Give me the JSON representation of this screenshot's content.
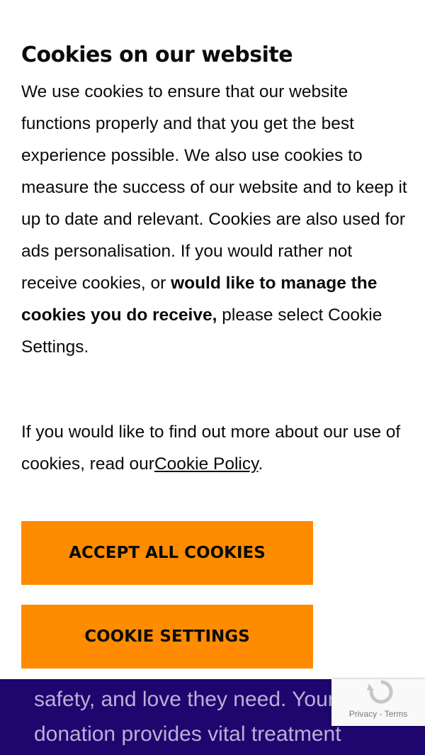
{
  "cookie_banner": {
    "title": "Cookies on our website",
    "body_intro": "We use cookies to ensure that our website functions properly and that you get the best experience possible. We also use cookies to measure the success of our website and to keep it up to date and relevant. Cookies are also used for ads personalisation. If you would rather not receive cookies, or ",
    "body_emphasis": "would like to manage the cookies you do receive,",
    "body_outro": " please select Cookie Settings.",
    "policy_intro": "If you would like to find out more about our use of cookies, read our",
    "policy_link": "Cookie Policy",
    "policy_end": ".",
    "accept_button": "ACCEPT ALL COOKIES",
    "settings_button": "COOKIE SETTINGS",
    "button_color": "#ff8c00"
  },
  "background": {
    "line1": "safety, and love they need. Your",
    "line2": "donation provides vital treatment",
    "color": "#1e066e"
  },
  "recaptcha": {
    "privacy": "Privacy",
    "separator": " - ",
    "terms": "Terms"
  }
}
